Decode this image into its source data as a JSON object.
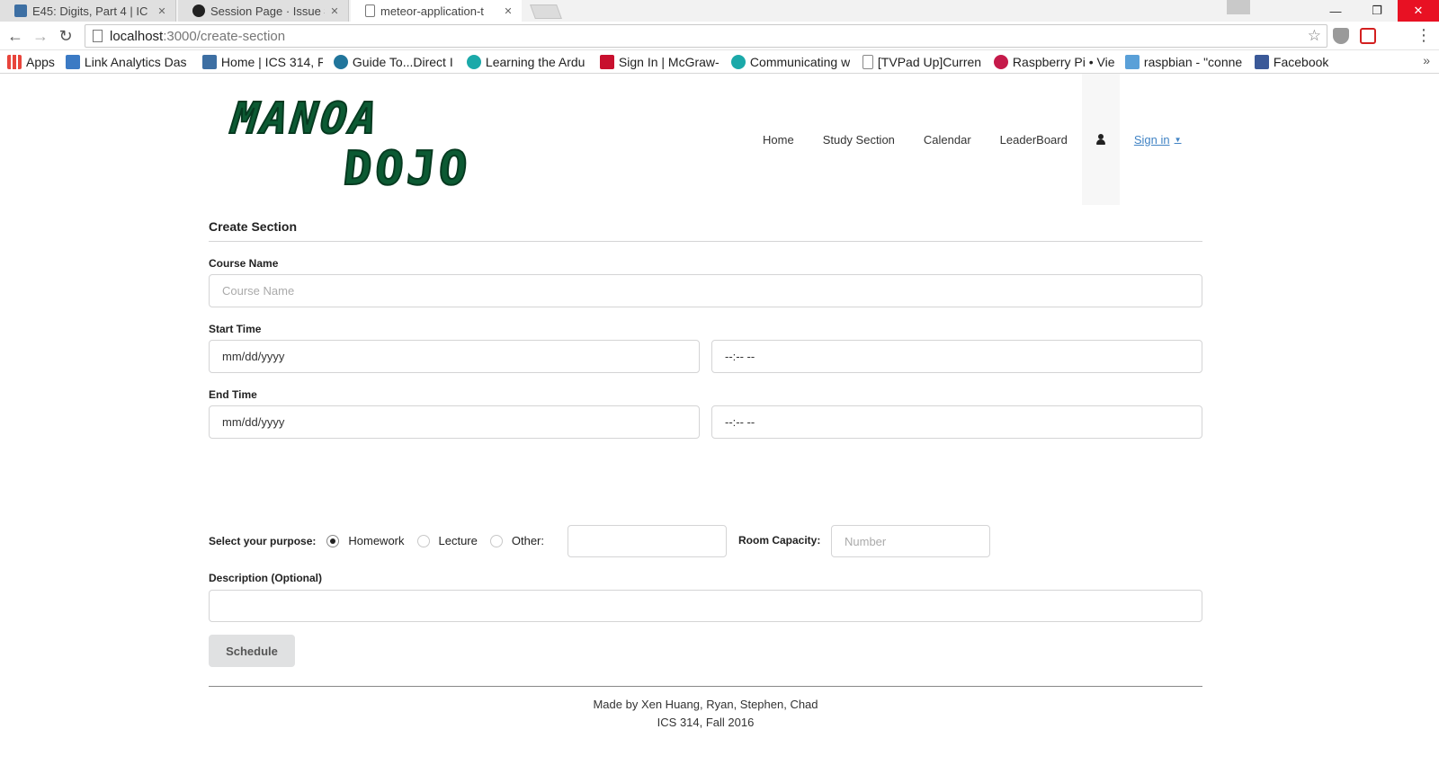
{
  "browser": {
    "tabs": [
      {
        "title": "E45: Digits, Part 4 | IC",
        "active": false
      },
      {
        "title": "Session Page · Issue #",
        "active": false
      },
      {
        "title": "meteor-application-t",
        "active": true
      }
    ],
    "address": {
      "host": "localhost",
      "path": ":3000/create-section"
    },
    "bookmarks": [
      {
        "label": "Apps",
        "icon": "apps-grid-icon",
        "color": "#e8453c"
      },
      {
        "label": "Link Analytics Das",
        "icon": "tuo-icon",
        "color": "#3b7ac4"
      },
      {
        "label": "Home | ICS 314, F",
        "icon": "page-icon",
        "color": "#3d6fa3"
      },
      {
        "label": "Guide To...Direct I",
        "icon": "wordpress-icon",
        "color": "#21759b"
      },
      {
        "label": "Learning the Ardu",
        "icon": "circle-icon",
        "color": "#1ba9a9"
      },
      {
        "label": "Sign In | McGraw-",
        "icon": "mcgraw-icon",
        "color": "#c8102e"
      },
      {
        "label": "Communicating w",
        "icon": "circle-icon",
        "color": "#1ba9a9"
      },
      {
        "label": "[TVPad Up]Curren",
        "icon": "page-icon",
        "color": "#888888"
      },
      {
        "label": "Raspberry Pi • Vie",
        "icon": "raspberry-icon",
        "color": "#c51a4a"
      },
      {
        "label": "raspbian - \"conne",
        "icon": "rpi-icon",
        "color": "#5aa0d8"
      },
      {
        "label": "Facebook",
        "icon": "facebook-icon",
        "color": "#3b5998"
      }
    ]
  },
  "logo": {
    "line1": "MANOA",
    "line2": "DOJO",
    "color": "#0c5a33"
  },
  "nav": {
    "items": [
      "Home",
      "Study Section",
      "Calendar",
      "LeaderBoard"
    ],
    "signin": "Sign in"
  },
  "form": {
    "title": "Create Section",
    "course_name": {
      "label": "Course Name",
      "placeholder": "Course Name"
    },
    "start_time": {
      "label": "Start Time",
      "date": "mm/dd/yyyy",
      "time": "--:-- --"
    },
    "end_time": {
      "label": "End Time",
      "date": "mm/dd/yyyy",
      "time": "--:-- --"
    },
    "purpose": {
      "label": "Select your purpose:",
      "options": [
        "Homework",
        "Lecture",
        "Other:"
      ],
      "selected": "Homework"
    },
    "room_capacity": {
      "label": "Room Capacity:",
      "placeholder": "Number"
    },
    "description": {
      "label": "Description (Optional)"
    },
    "submit": "Schedule"
  },
  "footer": {
    "line1": "Made by Xen Huang, Ryan, Stephen, Chad",
    "line2": "ICS 314, Fall 2016"
  }
}
